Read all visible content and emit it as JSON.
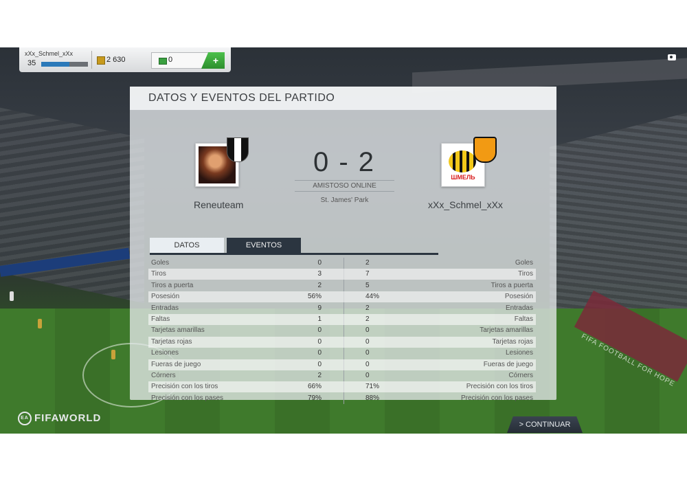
{
  "user": {
    "name": "xXx_Schmel_xXx",
    "level": "35",
    "level_progress": 0.6,
    "coins": "2 630",
    "points": "0",
    "add_label": "+"
  },
  "panel": {
    "title": "DATOS Y EVENTOS DEL PARTIDO",
    "home_team": "Reneuteam",
    "away_team": "xXx_Schmel_xXx",
    "score": "0 - 2",
    "match_type": "AMISTOSO ONLINE",
    "venue": "St. James' Park",
    "away_badge_text": "ШМЕЛЬ",
    "tabs": [
      {
        "label": "DATOS"
      },
      {
        "label": "EVENTOS"
      }
    ]
  },
  "stats": [
    {
      "label": "Goles",
      "home": "0",
      "away": "2"
    },
    {
      "label": "Tiros",
      "home": "3",
      "away": "7"
    },
    {
      "label": "Tiros a puerta",
      "home": "2",
      "away": "5"
    },
    {
      "label": "Posesión",
      "home": "56%",
      "away": "44%"
    },
    {
      "label": "Entradas",
      "home": "9",
      "away": "2"
    },
    {
      "label": "Faltas",
      "home": "1",
      "away": "2"
    },
    {
      "label": "Tarjetas amarillas",
      "home": "0",
      "away": "0"
    },
    {
      "label": "Tarjetas rojas",
      "home": "0",
      "away": "0"
    },
    {
      "label": "Lesiones",
      "home": "0",
      "away": "0"
    },
    {
      "label": "Fueras de juego",
      "home": "0",
      "away": "0"
    },
    {
      "label": "Córners",
      "home": "2",
      "away": "0"
    },
    {
      "label": "Precisión con los tiros",
      "home": "66%",
      "away": "71%"
    },
    {
      "label": "Precisión con los pases",
      "home": "79%",
      "away": "88%"
    }
  ],
  "footer": {
    "brand_ea": "EA",
    "brand": "FIFAWORLD",
    "continue_label": "> CONTINUAR"
  },
  "ads": {
    "right_board": "FIFA FOOTBALL FOR HOPE"
  },
  "icons": [
    "coin-icon",
    "points-icon",
    "camera-icon",
    "ea-logo-icon"
  ]
}
